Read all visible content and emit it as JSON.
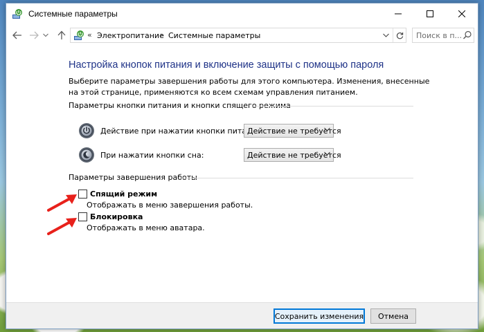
{
  "window": {
    "title": "Системные параметры",
    "accent": "#1e3287"
  },
  "address": {
    "prefix": "«",
    "separator": "›",
    "crumbs": [
      "Электропитание",
      "Системные параметры"
    ]
  },
  "search": {
    "placeholder": "Поиск в п..."
  },
  "page": {
    "title": "Настройка кнопок питания и включение защиты с помощью пароля",
    "description": "Выберите параметры завершения работы для этого компьютера. Изменения, внесенные на этой странице, применяются ко всем схемам управления питанием."
  },
  "power_section": {
    "header": "Параметры кнопки питания и кнопки спящего режима",
    "rows": [
      {
        "label": "Действие при нажатии кнопки питания:",
        "value": "Действие не требуется",
        "icon": "power-icon"
      },
      {
        "label": "При нажатии кнопки сна:",
        "value": "Действие не требуется",
        "icon": "sleep-icon"
      }
    ]
  },
  "shutdown_section": {
    "header": "Параметры завершения работы",
    "options": [
      {
        "label": "Спящий режим",
        "description": "Отображать в меню завершения работы.",
        "checked": false
      },
      {
        "label": "Блокировка",
        "description": "Отображать в меню аватара.",
        "checked": false
      }
    ]
  },
  "footer": {
    "save_label": "Сохранить изменения",
    "cancel_label": "Отмена"
  },
  "annotation_color": "#e8211b"
}
